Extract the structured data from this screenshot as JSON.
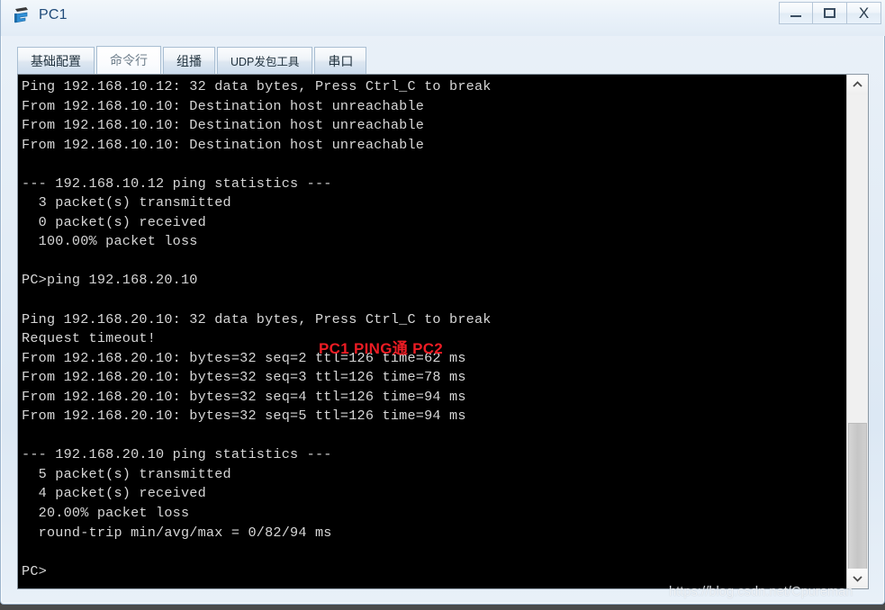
{
  "window": {
    "title": "PC1",
    "icon": "pc-device-icon",
    "controls": {
      "minimize": "minimize-icon",
      "maximize": "maximize-icon",
      "close": "X"
    }
  },
  "tabs": [
    {
      "label": "基础配置",
      "active": false,
      "small": false
    },
    {
      "label": "命令行",
      "active": true,
      "small": false
    },
    {
      "label": "组播",
      "active": false,
      "small": false
    },
    {
      "label": "UDP发包工具",
      "active": false,
      "small": true
    },
    {
      "label": "串口",
      "active": false,
      "small": false
    }
  ],
  "terminal": {
    "background_color": "#000000",
    "text_color": "#d6d6d6",
    "lines": [
      "Ping 192.168.10.12: 32 data bytes, Press Ctrl_C to break",
      "From 192.168.10.10: Destination host unreachable",
      "From 192.168.10.10: Destination host unreachable",
      "From 192.168.10.10: Destination host unreachable",
      "",
      "--- 192.168.10.12 ping statistics ---",
      "  3 packet(s) transmitted",
      "  0 packet(s) received",
      "  100.00% packet loss",
      "",
      "PC>ping 192.168.20.10",
      "",
      "Ping 192.168.20.10: 32 data bytes, Press Ctrl_C to break",
      "Request timeout!",
      "From 192.168.20.10: bytes=32 seq=2 ttl=126 time=62 ms",
      "From 192.168.20.10: bytes=32 seq=3 ttl=126 time=78 ms",
      "From 192.168.20.10: bytes=32 seq=4 ttl=126 time=94 ms",
      "From 192.168.20.10: bytes=32 seq=5 ttl=126 time=94 ms",
      "",
      "--- 192.168.20.10 ping statistics ---",
      "  5 packet(s) transmitted",
      "  4 packet(s) received",
      "  20.00% packet loss",
      "  round-trip min/avg/max = 0/82/94 ms",
      "",
      "PC>"
    ]
  },
  "annotation": {
    "text": "PC1 PING通 PC2",
    "color": "#ed1c24"
  },
  "scrollbar": {
    "up_arrow": "chevron-up-icon",
    "down_arrow": "chevron-down-icon"
  },
  "watermark": {
    "text": "https://blog.csdn.net/Cpureman"
  }
}
